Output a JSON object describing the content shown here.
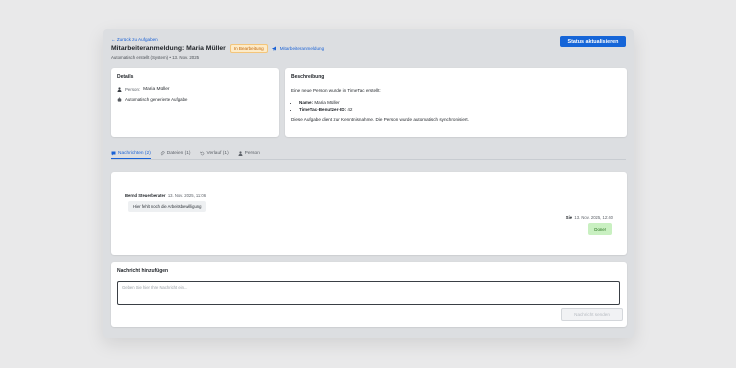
{
  "header": {
    "back_label": "← Zurück zu Aufgaben",
    "title": "Mitarbeiteranmeldung: Maria Müller",
    "status_badge": "In Bearbeitung",
    "type_link": "Mitarbeiteranmeldung",
    "meta": "Automatisch erstellt (System) • 13. Nov. 2025",
    "primary_button": "Status aktualisieren"
  },
  "details": {
    "title": "Details",
    "person_label": "Person:",
    "person_name": "Maria Müller",
    "auto_label": "Automatisch generierte Aufgabe"
  },
  "description": {
    "title": "Beschreibung",
    "intro": "Eine neue Person wurde in TimeTac erstellt:",
    "items": [
      {
        "key": "Name:",
        "value": "Maria Müller"
      },
      {
        "key": "TimeTac-Benutzer-ID:",
        "value": "42"
      }
    ],
    "note": "Diese Aufgabe dient zur Kenntnisnahme. Die Person wurde automatisch synchronisiert."
  },
  "tabs": [
    {
      "label": "Nachrichten (2)",
      "icon": "chat-icon",
      "active": true
    },
    {
      "label": "Dateien (1)",
      "icon": "paperclip-icon",
      "active": false
    },
    {
      "label": "Verlauf (1)",
      "icon": "history-icon",
      "active": false
    },
    {
      "label": "Person",
      "icon": "person-icon",
      "active": false
    }
  ],
  "messages": [
    {
      "author": "Bernd Steuerberater",
      "time": "13. Nov. 2025, 11:06",
      "text": "Hier fehlt noch die Arbeitsbewilligung",
      "side": "left"
    },
    {
      "author": "Sie",
      "time": "13. Nov. 2025, 12:40",
      "text": "Done!",
      "side": "right"
    }
  ],
  "compose": {
    "title": "Nachricht hinzufügen",
    "placeholder": "Geben Sie hier Ihre Nachricht ein...",
    "send_label": "Nachricht senden"
  },
  "colors": {
    "accent": "#1565d8",
    "badge_bg": "#fdebc8",
    "badge_text": "#c2660a",
    "reply_bubble": "#c9f0c1"
  }
}
